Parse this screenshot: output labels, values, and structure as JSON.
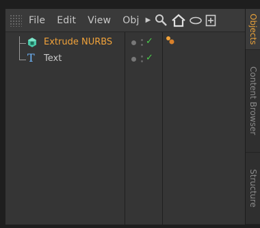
{
  "menu": {
    "items": [
      "File",
      "Edit",
      "View",
      "Obj"
    ],
    "toolbar_icons": [
      "search-icon",
      "home-icon",
      "eye-icon",
      "new-window-icon"
    ]
  },
  "tabs": [
    {
      "label": "Objects",
      "active": true
    },
    {
      "label": "Content Browser",
      "active": false
    },
    {
      "label": "Structure",
      "active": false
    }
  ],
  "objects": [
    {
      "name": "Extrude NURBS",
      "selected": true,
      "icon": "extrude-nurbs-icon",
      "visible_check": true,
      "has_tag": true
    },
    {
      "name": "Text",
      "selected": false,
      "icon": "text-spline-icon",
      "visible_check": true,
      "has_tag": false
    }
  ],
  "colors": {
    "accent": "#f2a33a",
    "check": "#4bd14b",
    "panel": "#353535"
  }
}
